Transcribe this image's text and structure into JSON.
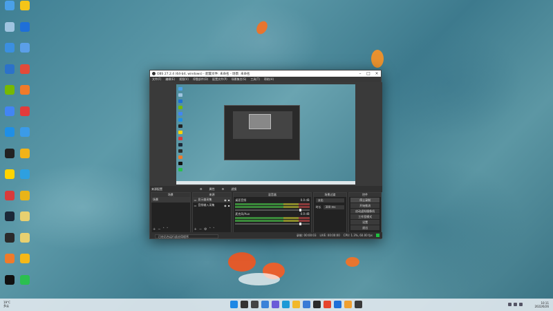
{
  "desktop_icons": [
    {
      "name": "desktop-icon-1",
      "color": "#4aa0e8",
      "label": ""
    },
    {
      "name": "desktop-icon-2",
      "color": "#f5c518",
      "label": ""
    },
    {
      "name": "desktop-icon-3",
      "color": "#9fc4e0",
      "label": ""
    },
    {
      "name": "desktop-icon-4",
      "color": "#1e6fd8",
      "label": ""
    },
    {
      "name": "desktop-icon-5",
      "color": "#3b8fe0",
      "label": ""
    },
    {
      "name": "desktop-icon-6",
      "color": "#5b9fe8",
      "label": ""
    },
    {
      "name": "desktop-icon-7",
      "color": "#2c72c9",
      "label": ""
    },
    {
      "name": "desktop-icon-8",
      "color": "#e24b3a",
      "label": ""
    },
    {
      "name": "desktop-icon-9",
      "color": "#76b900",
      "label": ""
    },
    {
      "name": "desktop-icon-10",
      "color": "#f07b2a",
      "label": ""
    },
    {
      "name": "desktop-icon-11",
      "color": "#4285f4",
      "label": ""
    },
    {
      "name": "desktop-icon-12",
      "color": "#e23b3b",
      "label": ""
    },
    {
      "name": "desktop-icon-13",
      "color": "#1f8fe6",
      "label": ""
    },
    {
      "name": "desktop-icon-14",
      "color": "#3b9be8",
      "label": ""
    },
    {
      "name": "desktop-icon-15",
      "color": "#222222",
      "label": ""
    },
    {
      "name": "desktop-icon-16",
      "color": "#f2b318",
      "label": ""
    },
    {
      "name": "desktop-icon-17",
      "color": "#ffd400",
      "label": ""
    },
    {
      "name": "desktop-icon-18",
      "color": "#2ea0e0",
      "label": ""
    },
    {
      "name": "desktop-icon-19",
      "color": "#d93b3b",
      "label": ""
    },
    {
      "name": "desktop-icon-20",
      "color": "#e8b418",
      "label": ""
    },
    {
      "name": "desktop-icon-21",
      "color": "#1b2838",
      "label": ""
    },
    {
      "name": "desktop-icon-22",
      "color": "#e8d070",
      "label": ""
    },
    {
      "name": "desktop-icon-23",
      "color": "#2b2b2b",
      "label": ""
    },
    {
      "name": "desktop-icon-24",
      "color": "#e8d070",
      "label": ""
    },
    {
      "name": "desktop-icon-25",
      "color": "#f07b2a",
      "label": ""
    },
    {
      "name": "desktop-icon-26",
      "color": "#f5b818",
      "label": ""
    },
    {
      "name": "desktop-icon-27",
      "color": "#111111",
      "label": ""
    },
    {
      "name": "desktop-icon-28",
      "color": "#2bbf4f",
      "label": ""
    }
  ],
  "obs": {
    "title": "OBS 27.2.4 (64-bit, windows) - 配置文件: 未命名 - 场景: 未命名",
    "menu": [
      "文件(F)",
      "编辑(E)",
      "视图(V)",
      "停靠部件(D)",
      "配置文件(P)",
      "场景集合(S)",
      "工具(T)",
      "帮助(H)"
    ],
    "scene_toolbar": {
      "label": "来源配置",
      "props": "属性",
      "filters": "滤镜"
    },
    "docks": {
      "scenes": {
        "title": "场景",
        "items": [
          "场景"
        ]
      },
      "sources": {
        "title": "来源",
        "items": [
          "显示器采集",
          "音频输入采集"
        ]
      },
      "mixer": {
        "title": "混音器",
        "channels": [
          {
            "name": "桌面音频",
            "db": "0.0 dB"
          },
          {
            "name": "麦克风/Aux",
            "db": "0.0 dB"
          }
        ]
      },
      "transitions": {
        "title": "场景过渡",
        "type": "淡出",
        "duration_label": "时长",
        "duration": "300 ms"
      },
      "controls": {
        "title": "控件",
        "buttons": [
          "停止录制",
          "开始推流",
          "启动虚拟摄像机",
          "工作室模式",
          "设置",
          "退出"
        ]
      }
    },
    "status": {
      "rec_time": "录制: 00:00:03",
      "live_time": "LIVE: 00:00:00",
      "cpu": "CPU: 1.3%, 60.00 fps",
      "dropped": "00:00:03"
    },
    "notification": "已在后台运行此应用程序"
  },
  "taskbar": {
    "weather_temp": "19°C",
    "weather_desc": "多云",
    "time": "10:11",
    "date": "2022/6/26",
    "apps": [
      {
        "name": "start-icon",
        "color": "#1e88e5"
      },
      {
        "name": "search-icon",
        "color": "#333333"
      },
      {
        "name": "taskview-icon",
        "color": "#444444"
      },
      {
        "name": "widgets-icon",
        "color": "#3b82d8"
      },
      {
        "name": "chat-icon",
        "color": "#6b5bd8"
      },
      {
        "name": "edge-icon",
        "color": "#1b9ad6"
      },
      {
        "name": "explorer-icon",
        "color": "#f2b82a"
      },
      {
        "name": "store-icon",
        "color": "#3b7bd6"
      },
      {
        "name": "app-icon-1",
        "color": "#2b2b2b"
      },
      {
        "name": "app-icon-2",
        "color": "#e6442d"
      },
      {
        "name": "app-icon-3",
        "color": "#1e6fd8"
      },
      {
        "name": "app-icon-4",
        "color": "#f0a030"
      },
      {
        "name": "obs-icon",
        "color": "#3a3a3a"
      }
    ]
  }
}
